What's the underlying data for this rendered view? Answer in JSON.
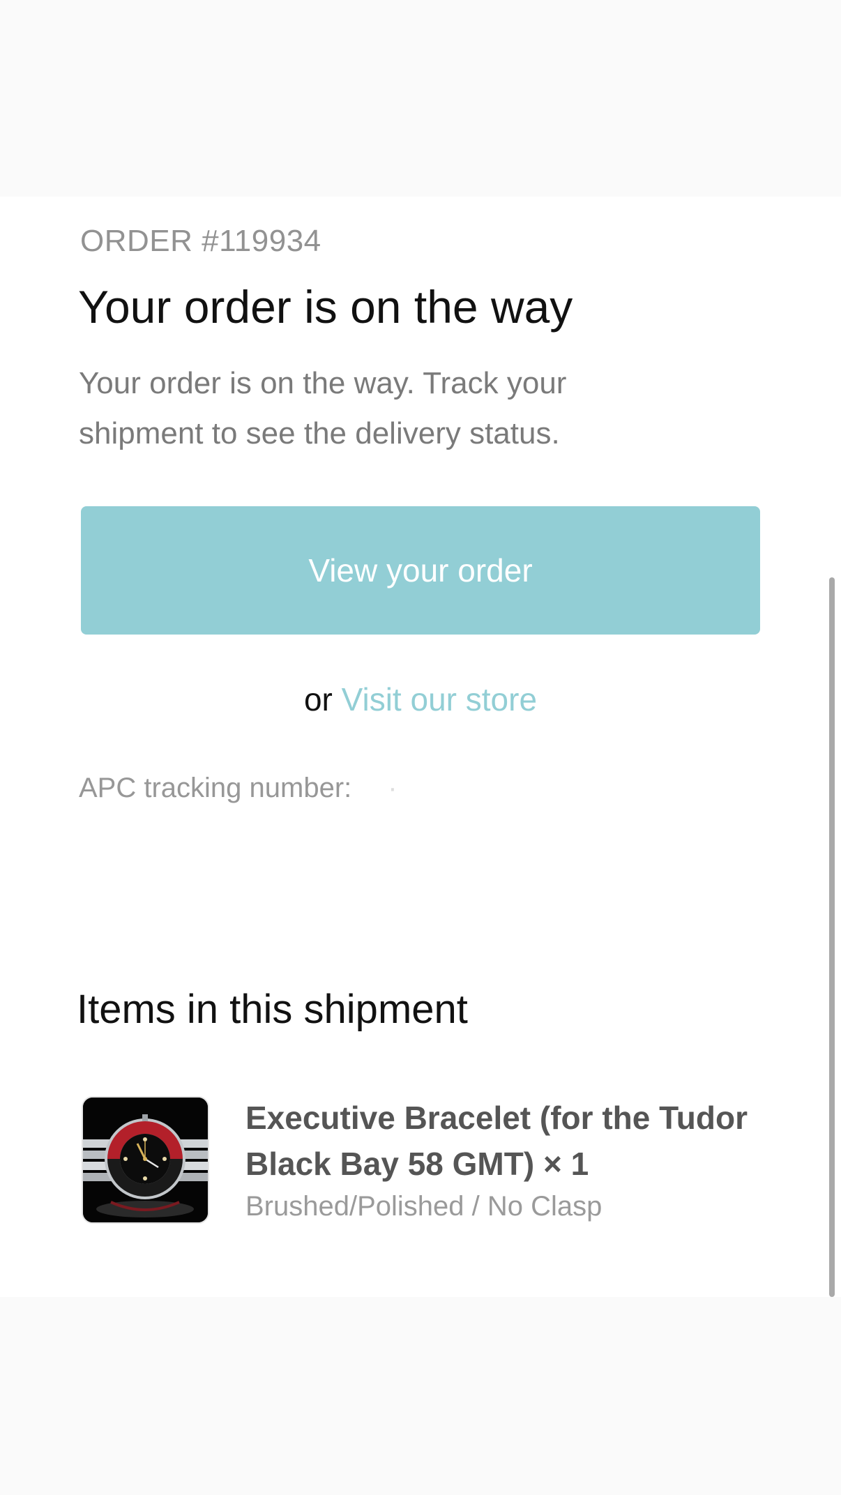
{
  "order": {
    "number_label": "ORDER #119934",
    "headline": "Your order is on the way",
    "description": "Your order is on the way. Track your shipment to see the delivery status."
  },
  "actions": {
    "view_order_label": "View your order",
    "or_label": "or",
    "visit_store_label": "Visit our store"
  },
  "tracking": {
    "label": "APC tracking number:",
    "value": "·"
  },
  "shipment": {
    "heading": "Items in this shipment",
    "items": [
      {
        "title": "Executive Bracelet (for the Tudor Black Bay 58 GMT) × 1",
        "variant": "Brushed/Polished / No Clasp",
        "image_icon": "watch-product-image"
      }
    ]
  },
  "colors": {
    "accent": "#92ced5",
    "text_primary": "#111111",
    "text_muted": "#7a7a7a",
    "page_background": "#fafafa",
    "card_background": "#ffffff"
  }
}
